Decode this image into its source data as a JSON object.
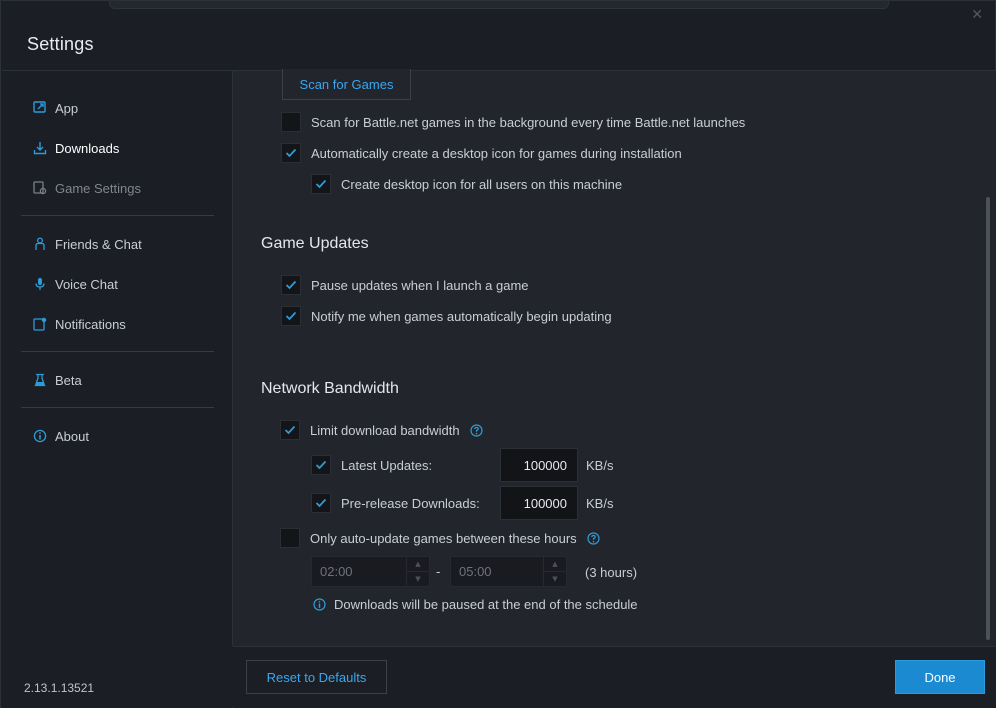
{
  "window": {
    "title": "Settings",
    "version": "2.13.1.13521",
    "close_glyph": "✕"
  },
  "sidebar": {
    "items": [
      {
        "label": "App",
        "icon": "app-icon"
      },
      {
        "label": "Downloads",
        "icon": "download-icon",
        "active": true
      },
      {
        "label": "Game Settings",
        "icon": "game-settings-icon",
        "disabled": true
      },
      {
        "label": "Friends & Chat",
        "icon": "friends-icon"
      },
      {
        "label": "Voice Chat",
        "icon": "microphone-icon"
      },
      {
        "label": "Notifications",
        "icon": "notification-icon"
      },
      {
        "label": "Beta",
        "icon": "beta-flask-icon"
      },
      {
        "label": "About",
        "icon": "info-icon"
      }
    ]
  },
  "install": {
    "scan_button": "Scan for Games",
    "scan_background": {
      "label": "Scan for Battle.net games in the background every time Battle.net launches",
      "checked": false
    },
    "desktop_icon": {
      "label": "Automatically create a desktop icon for games during installation",
      "checked": true
    },
    "all_users": {
      "label": "Create desktop icon for all users on this machine",
      "checked": true
    }
  },
  "game_updates": {
    "title": "Game Updates",
    "pause_updates": {
      "label": "Pause updates when I launch a game",
      "checked": true
    },
    "notify": {
      "label": "Notify me when games automatically begin updating",
      "checked": true
    }
  },
  "network": {
    "title": "Network Bandwidth",
    "limit": {
      "label": "Limit download bandwidth",
      "checked": true
    },
    "latest": {
      "label": "Latest Updates:",
      "checked": true,
      "value": "100000",
      "unit": "KB/s"
    },
    "prerelease": {
      "label": "Pre-release Downloads:",
      "checked": true,
      "value": "100000",
      "unit": "KB/s"
    },
    "schedule": {
      "label": "Only auto-update games between these hours",
      "checked": false
    },
    "start_time": "02:00",
    "dash": "-",
    "end_time": "05:00",
    "duration": "(3 hours)",
    "info": "Downloads will be paused at the end of the schedule"
  },
  "footer": {
    "reset": "Reset to Defaults",
    "done": "Done"
  },
  "colors": {
    "accent": "#2e9bd9",
    "link": "#3aa7f0",
    "done_bg": "#1c8ad1"
  }
}
